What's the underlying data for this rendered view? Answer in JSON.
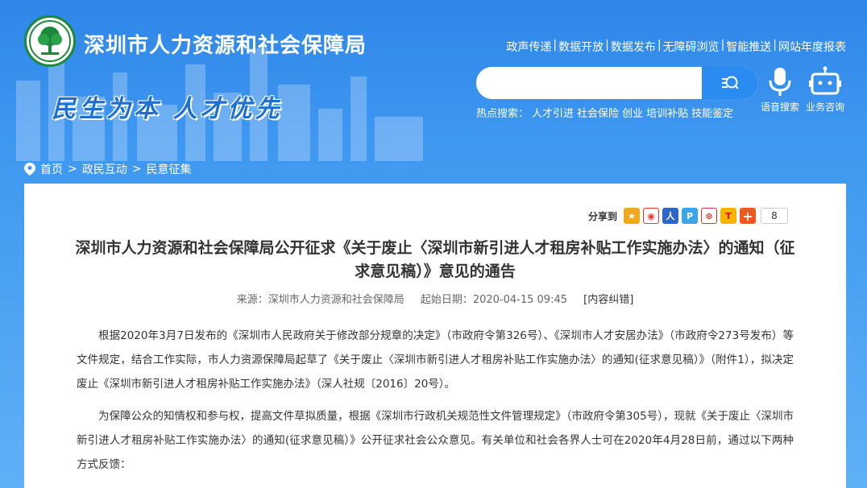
{
  "header": {
    "site_title": "深圳市人力资源和社会保障局",
    "slogan": "民生为本 人才优先",
    "top_links": [
      "政声传递",
      "数据开放",
      "数据发布",
      "无障碍浏览",
      "智能推送",
      "网站年度报表"
    ],
    "search": {
      "value": "",
      "placeholder": ""
    },
    "hot_search_label": "热点搜索：",
    "hot_search_items": [
      "人才引进",
      "社会保险",
      "创业",
      "培训补贴",
      "技能鉴定"
    ],
    "voice_search_label": "语音搜索",
    "consult_label": "业务咨询"
  },
  "breadcrumb": [
    "首页",
    "政民互动",
    "民意征集"
  ],
  "breadcrumb_sep": ">",
  "share": {
    "label": "分享到",
    "count": "8"
  },
  "article": {
    "title": "深圳市人力资源和社会保障局公开征求《关于废止〈深圳市新引进人才租房补贴工作实施办法〉的通知（征求意见稿）》意见的通告",
    "source": "来源：深圳市人力资源和社会保障局",
    "date": "起始日期：2020-04-15 09:45",
    "errata": "[内容纠错]",
    "paragraphs": [
      "根据2020年3月7日发布的《深圳市人民政府关于修改部分规章的决定》（市政府令第326号）、《深圳市人才安居办法》（市政府令273号发布）等文件规定，结合工作实际，市人力资源保障局起草了《关于废止〈深圳市新引进人才租房补贴工作实施办法〉的通知(征求意见稿）》（附件1），拟决定废止《深圳市新引进人才租房补贴工作实施办法》（深人社规〔2016〕20号）。",
      "为保障公众的知情权和参与权，提高文件草拟质量，根据《深圳市行政机关规范性文件管理规定》（市政府令第305号），现就《关于废止〈深圳市新引进人才租房补贴工作实施办法〉的通知(征求意见稿）》公开征求社会公众意见。有关单位和社会各界人士可在2020年4月28日前，通过以下两种方式反馈："
    ]
  },
  "colors": {
    "header_blue": "#2f86e8",
    "logo_green": "#1a8a3a",
    "slogan_blue": "#1d6fd1"
  }
}
